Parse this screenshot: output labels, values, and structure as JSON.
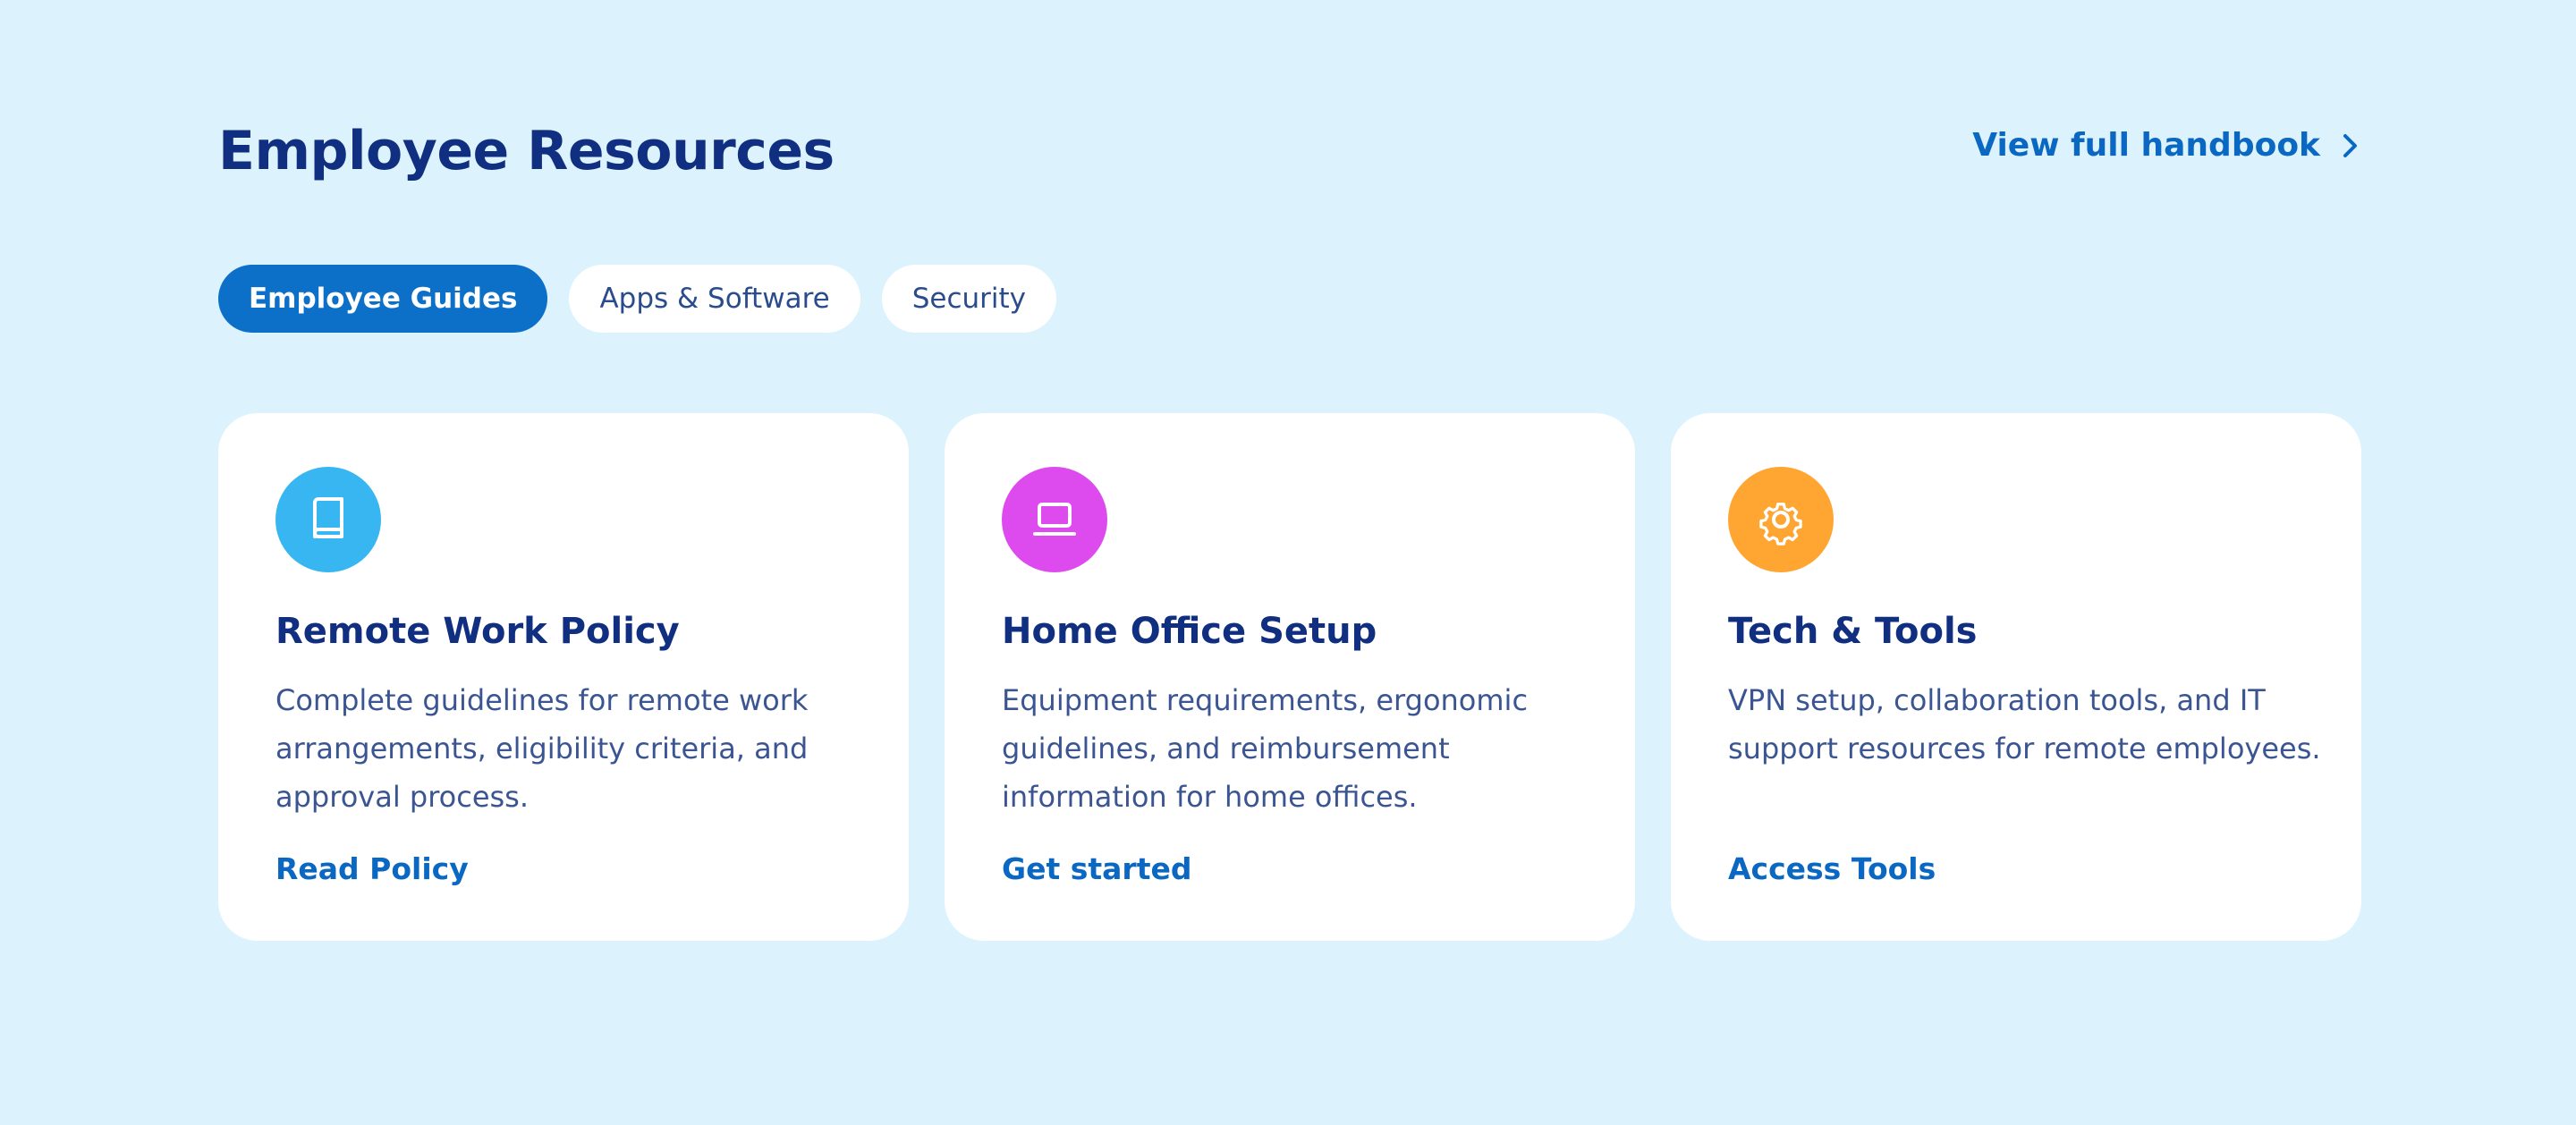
{
  "header": {
    "title": "Employee Resources",
    "handbook_link": "View full handbook",
    "handbook_icon": "chevron-right-icon"
  },
  "tabs": [
    {
      "label": "Employee Guides",
      "active": true
    },
    {
      "label": "Apps & Software",
      "active": false
    },
    {
      "label": "Security",
      "active": false
    }
  ],
  "cards": [
    {
      "icon": "book-icon",
      "icon_color": "#38b6f2",
      "title": "Remote Work Policy",
      "description": "Complete guidelines for remote work arrangements, eligibility criteria, and approval process.",
      "link": "Read Policy"
    },
    {
      "icon": "laptop-icon",
      "icon_color": "#dd4bee",
      "title": "Home Office Setup",
      "description": "Equipment requirements, ergonomic guidelines, and reimbursement information for home offices.",
      "link": "Get started"
    },
    {
      "icon": "gear-icon",
      "icon_color": "#ffa532",
      "title": "Tech & Tools",
      "description": "VPN setup, collaboration tools, and IT support resources for remote employees.",
      "link": "Access Tools"
    }
  ],
  "colors": {
    "background": "#dcf3fd",
    "heading": "#112f80",
    "accent": "#0c6fc8",
    "link": "#0b68c2",
    "body_text": "#3b5592"
  }
}
